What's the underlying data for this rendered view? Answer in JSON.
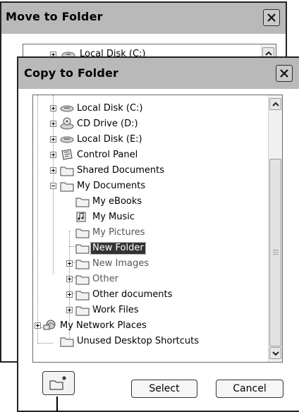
{
  "back_dialog": {
    "title": "Move to Folder",
    "tree_first_item": "Local Disk (C:)"
  },
  "front_dialog": {
    "title": "Copy to Folder",
    "tree": [
      {
        "label": "Local Disk (C:)",
        "icon": "drive-icon",
        "expander": "+",
        "level": 1,
        "selected": false,
        "dim": false
      },
      {
        "label": "CD Drive (D:)",
        "icon": "cd-drive-icon",
        "expander": "+",
        "level": 1,
        "selected": false,
        "dim": false
      },
      {
        "label": "Local Disk (E:)",
        "icon": "drive-icon",
        "expander": "+",
        "level": 1,
        "selected": false,
        "dim": false
      },
      {
        "label": "Control Panel",
        "icon": "control-panel-icon",
        "expander": "+",
        "level": 1,
        "selected": false,
        "dim": false
      },
      {
        "label": "Shared Documents",
        "icon": "folder-icon",
        "expander": "+",
        "level": 1,
        "selected": false,
        "dim": false
      },
      {
        "label": "My Documents",
        "icon": "folder-icon",
        "expander": "-",
        "level": 1,
        "selected": false,
        "dim": false
      },
      {
        "label": "My eBooks",
        "icon": "folder-icon",
        "expander": "",
        "level": 2,
        "selected": false,
        "dim": false
      },
      {
        "label": "My Music",
        "icon": "music-folder-icon",
        "expander": "",
        "level": 2,
        "selected": false,
        "dim": false
      },
      {
        "label": "My Pictures",
        "icon": "folder-icon",
        "expander": "",
        "level": 2,
        "selected": false,
        "dim": true
      },
      {
        "label": "New Folder",
        "icon": "folder-icon",
        "expander": "",
        "level": 2,
        "selected": true,
        "dim": false
      },
      {
        "label": "New Images",
        "icon": "folder-icon",
        "expander": "+",
        "level": 2,
        "selected": false,
        "dim": true
      },
      {
        "label": "Other",
        "icon": "folder-icon",
        "expander": "+",
        "level": 2,
        "selected": false,
        "dim": true
      },
      {
        "label": "Other documents",
        "icon": "folder-icon",
        "expander": "+",
        "level": 2,
        "selected": false,
        "dim": false
      },
      {
        "label": "Work Files",
        "icon": "folder-icon",
        "expander": "+",
        "level": 2,
        "selected": false,
        "dim": false
      },
      {
        "label": "My Network Places",
        "icon": "network-icon",
        "expander": "+",
        "level": 0,
        "selected": false,
        "dim": false
      },
      {
        "label": "Unused Desktop Shortcuts",
        "icon": "folder-icon",
        "expander": "",
        "level": 0,
        "selected": false,
        "dim": false
      }
    ],
    "buttons": {
      "select": "Select",
      "cancel": "Cancel"
    }
  },
  "colors": {
    "titlebar": "#b9b9b9",
    "selection": "#333333",
    "folder_fill": "#f2f2f2"
  }
}
